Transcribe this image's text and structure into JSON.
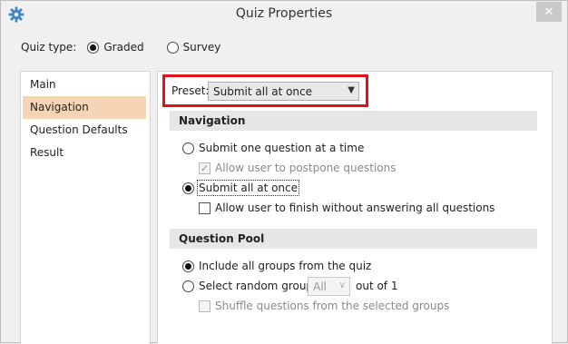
{
  "window": {
    "title": "Quiz Properties",
    "close_glyph": "✕",
    "icon": "gear-icon"
  },
  "quiz_type": {
    "label": "Quiz type:",
    "options": [
      {
        "label": "Graded",
        "checked": true
      },
      {
        "label": "Survey",
        "checked": false
      }
    ]
  },
  "sidebar": {
    "items": [
      {
        "label": "Main",
        "active": false
      },
      {
        "label": "Navigation",
        "active": true
      },
      {
        "label": "Question Defaults",
        "active": false
      },
      {
        "label": "Result",
        "active": false
      }
    ]
  },
  "preset": {
    "label": "Preset:",
    "value": "Submit all at once",
    "highlight_color": "#e2121a"
  },
  "navigation": {
    "heading": "Navigation",
    "submit_one": "Submit one question at a time",
    "allow_postpone": "Allow user to postpone questions",
    "submit_all": "Submit all at once",
    "allow_finish": "Allow user to finish without answering all questions"
  },
  "question_pool": {
    "heading": "Question Pool",
    "include_all": "Include all groups from the quiz",
    "select_random": "Select random groups:",
    "groups_value": "All",
    "out_of": "out of 1",
    "shuffle": "Shuffle questions from the selected groups"
  }
}
